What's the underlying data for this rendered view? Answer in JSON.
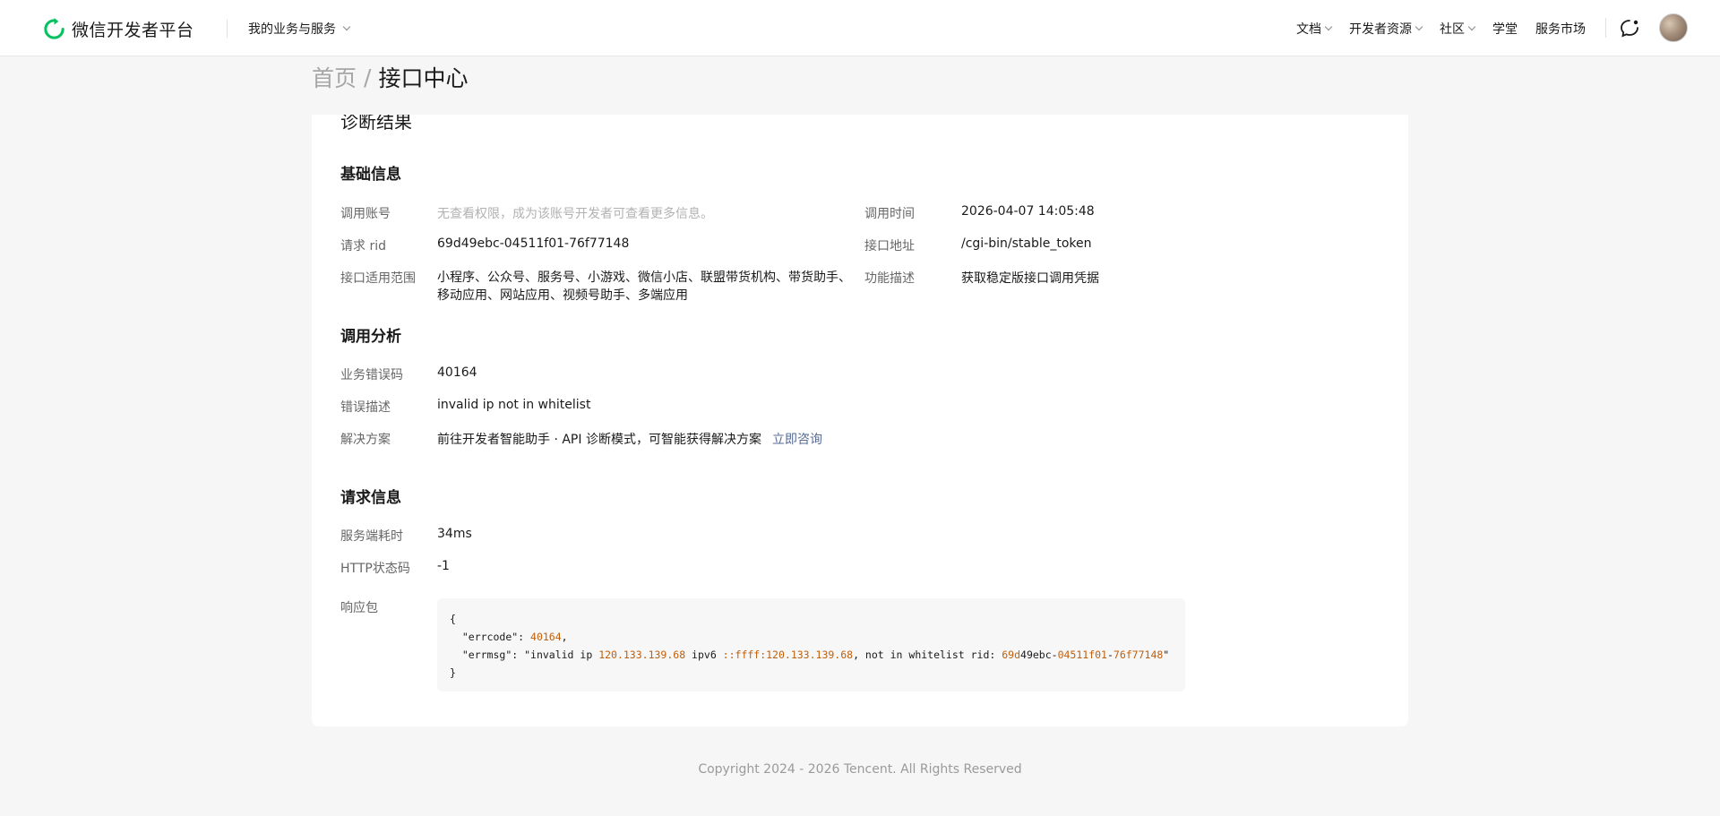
{
  "header": {
    "logo_text": "微信开发者平台",
    "biz_menu": "我的业务与服务",
    "nav": [
      "文档",
      "开发者资源",
      "社区",
      "学堂",
      "服务市场"
    ]
  },
  "breadcrumb": {
    "home": "首页",
    "sep": "/",
    "current": "接口中心"
  },
  "card": {
    "partial_title": "诊断结果",
    "basic": {
      "title": "基础信息",
      "account_label": "调用账号",
      "account_value": "无查看权限，成为该账号开发者可查看更多信息。",
      "time_label": "调用时间",
      "time_value": "2026-04-07 14:05:48",
      "rid_label": "请求 rid",
      "rid_value": "69d49ebc-04511f01-76f77148",
      "url_label": "接口地址",
      "url_value": "/cgi-bin/stable_token",
      "scope_label": "接口适用范围",
      "scope_value": "小程序、公众号、服务号、小游戏、微信小店、联盟带货机构、带货助手、移动应用、网站应用、视频号助手、多端应用",
      "func_label": "功能描述",
      "func_value": "获取稳定版接口调用凭据"
    },
    "analysis": {
      "title": "调用分析",
      "errcode_label": "业务错误码",
      "errcode_value": "40164",
      "errdesc_label": "错误描述",
      "errdesc_value": "invalid ip  not in whitelist",
      "solution_label": "解决方案",
      "solution_value": "前往开发者智能助手 · API 诊断模式，可智能获得解决方案",
      "solution_link": "立即咨询"
    },
    "request": {
      "title": "请求信息",
      "latency_label": "服务端耗时",
      "latency_value": "34ms",
      "http_label": "HTTP状态码",
      "http_value": "-1",
      "resp_label": "响应包",
      "resp_open": "{",
      "resp_errcode_key": "\"errcode\": ",
      "resp_errcode_val": "40164",
      "resp_errcode_comma": ",",
      "resp_errmsg_key": "\"errmsg\": \"invalid ip ",
      "resp_ip": "120.133.139.68",
      "resp_ipv6_text": " ipv6 ",
      "resp_ipv6": "::ffff:120.133.139.68",
      "resp_tail_text": ", not in whitelist rid: ",
      "resp_rid_a": "69d",
      "resp_rid_b": "49ebc-",
      "resp_rid_c": "04511f01",
      "resp_rid_d": "-",
      "resp_rid_e": "76f77148",
      "resp_rid_close": "\"",
      "resp_close": "}"
    }
  },
  "footer": {
    "copyright": "Copyright 2024 - 2026 Tencent. All Rights Reserved"
  }
}
